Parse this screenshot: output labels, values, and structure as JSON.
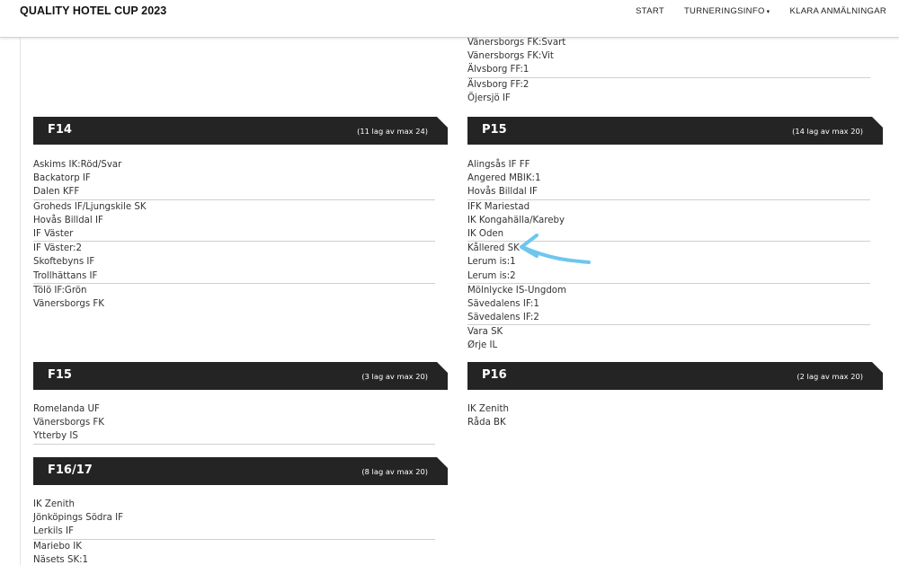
{
  "header": {
    "brand": "QUALITY HOTEL CUP 2023",
    "nav": [
      {
        "label": "START"
      },
      {
        "label": "TURNERINGSINFO",
        "caret": "▾"
      },
      {
        "label": "KLARA ANMÄLNINGAR"
      }
    ]
  },
  "divisions": {
    "top_continuation": {
      "teams": [
        "Vänersborgs FK:Svart",
        "Vänersborgs FK:Vit",
        "Älvsborg FF:1",
        "Älvsborg FF:2",
        "Öjersjö IF"
      ]
    },
    "f14": {
      "title": "F14",
      "count": "(11 lag av max 24)",
      "teams": [
        "Askims IK:Röd/Svar",
        "Backatorp IF",
        "Dalen KFF",
        "Groheds IF/Ljungskile SK",
        "Hovås Billdal IF",
        "IF Väster",
        "IF Väster:2",
        "Skoftebyns IF",
        "Trollhättans IF",
        "Tölö IF:Grön",
        "Vänersborgs FK"
      ]
    },
    "p15": {
      "title": "P15",
      "count": "(14 lag av max 20)",
      "teams": [
        "Alingsås IF FF",
        "Angered MBIK:1",
        "Hovås Billdal IF",
        "IFK Mariestad",
        "IK Kongahälla/Kareby",
        "IK Oden",
        "Kållered SK",
        "Lerum is:1",
        "Lerum is:2",
        "Mölnlycke IS-Ungdom",
        "Sävedalens IF:1",
        "Sävedalens IF:2",
        "Vara SK",
        "Ørje IL"
      ]
    },
    "f15": {
      "title": "F15",
      "count": "(3 lag av max 20)",
      "teams": [
        "Romelanda UF",
        "Vänersborgs FK",
        "Ytterby IS"
      ]
    },
    "p16": {
      "title": "P16",
      "count": "(2 lag av max 20)",
      "teams": [
        "IK Zenith",
        "Råda BK"
      ]
    },
    "f1617": {
      "title": "F16/17",
      "count": "(8 lag av max 20)",
      "teams": [
        "IK Zenith",
        "Jönköpings Södra IF",
        "Lerkils IF",
        "Mariebo IK",
        "Näsets SK:1"
      ]
    }
  },
  "annotation": {
    "arrow_color": "#6ec6ef",
    "points_to": "Kållered SK"
  }
}
